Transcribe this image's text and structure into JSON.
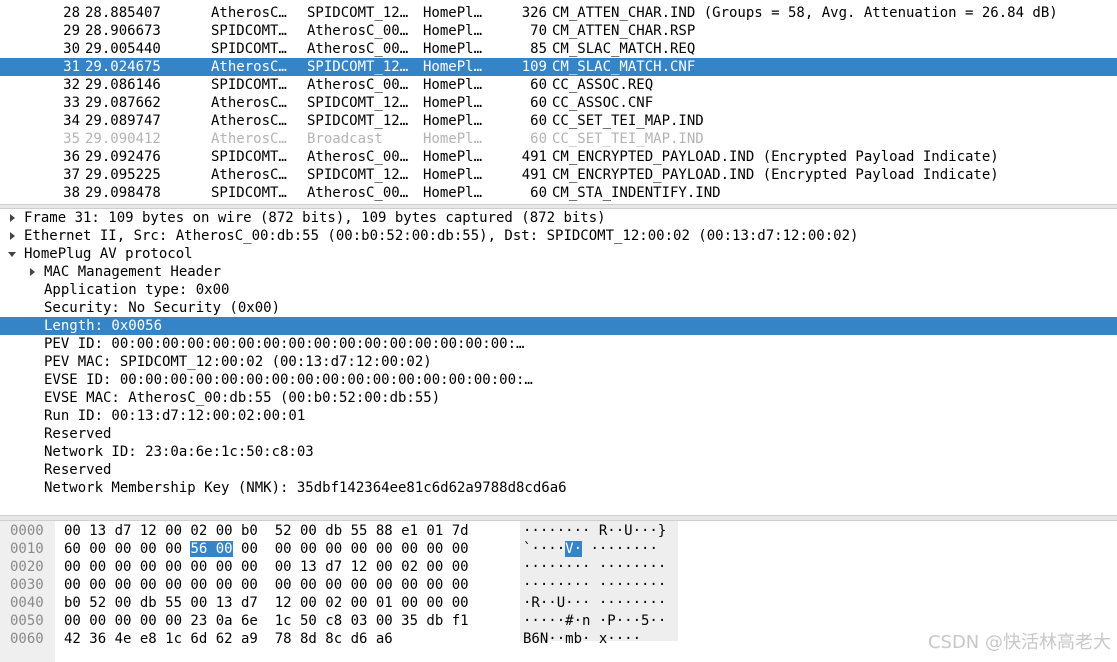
{
  "packet_list": {
    "rows": [
      {
        "no": "28",
        "time": "28.885407",
        "src": "AtherosC…",
        "dst": "SPIDCOMT_12…",
        "proto": "HomePl…",
        "len": "326",
        "info": "CM_ATTEN_CHAR.IND (Groups = 58, Avg. Attenuation = 26.84 dB)"
      },
      {
        "no": "29",
        "time": "28.906673",
        "src": "SPIDCOMT…",
        "dst": "AtherosC_00…",
        "proto": "HomePl…",
        "len": "70",
        "info": "CM_ATTEN_CHAR.RSP"
      },
      {
        "no": "30",
        "time": "29.005440",
        "src": "SPIDCOMT…",
        "dst": "AtherosC_00…",
        "proto": "HomePl…",
        "len": "85",
        "info": "CM_SLAC_MATCH.REQ"
      },
      {
        "no": "31",
        "time": "29.024675",
        "src": "AtherosC…",
        "dst": "SPIDCOMT_12…",
        "proto": "HomePl…",
        "len": "109",
        "info": "CM_SLAC_MATCH.CNF",
        "selected": true
      },
      {
        "no": "32",
        "time": "29.086146",
        "src": "SPIDCOMT…",
        "dst": "AtherosC_00…",
        "proto": "HomePl…",
        "len": "60",
        "info": "CC_ASSOC.REQ"
      },
      {
        "no": "33",
        "time": "29.087662",
        "src": "AtherosC…",
        "dst": "SPIDCOMT_12…",
        "proto": "HomePl…",
        "len": "60",
        "info": "CC_ASSOC.CNF"
      },
      {
        "no": "34",
        "time": "29.089747",
        "src": "AtherosC…",
        "dst": "SPIDCOMT_12…",
        "proto": "HomePl…",
        "len": "60",
        "info": "CC_SET_TEI_MAP.IND"
      },
      {
        "no": "35",
        "time": "29.090412",
        "src": "AtherosC…",
        "dst": "Broadcast",
        "proto": "HomePl…",
        "len": "60",
        "info": "CC_SET_TEI_MAP.IND",
        "dimmed": true
      },
      {
        "no": "36",
        "time": "29.092476",
        "src": "SPIDCOMT…",
        "dst": "AtherosC_00…",
        "proto": "HomePl…",
        "len": "491",
        "info": "CM_ENCRYPTED_PAYLOAD.IND (Encrypted Payload Indicate)"
      },
      {
        "no": "37",
        "time": "29.095225",
        "src": "AtherosC…",
        "dst": "SPIDCOMT_12…",
        "proto": "HomePl…",
        "len": "491",
        "info": "CM_ENCRYPTED_PAYLOAD.IND (Encrypted Payload Indicate)"
      },
      {
        "no": "38",
        "time": "29.098478",
        "src": "SPIDCOMT…",
        "dst": "AtherosC_00…",
        "proto": "HomePl…",
        "len": "60",
        "info": "CM_STA_INDENTIFY.IND"
      }
    ]
  },
  "details": {
    "rows": [
      {
        "text": "Frame 31: 109 bytes on wire (872 bits), 109 bytes captured (872 bits)",
        "depth": 0,
        "expander": "collapsed"
      },
      {
        "text": "Ethernet II, Src: AtherosC_00:db:55 (00:b0:52:00:db:55), Dst: SPIDCOMT_12:00:02 (00:13:d7:12:00:02)",
        "depth": 0,
        "expander": "collapsed"
      },
      {
        "text": "HomePlug AV protocol",
        "depth": 0,
        "expander": "expanded"
      },
      {
        "text": "MAC Management Header",
        "depth": 1,
        "expander": "collapsed"
      },
      {
        "text": "Application type: 0x00",
        "depth": 1,
        "expander": "none"
      },
      {
        "text": "Security: No Security (0x00)",
        "depth": 1,
        "expander": "none"
      },
      {
        "text": "Length: 0x0056",
        "depth": 1,
        "expander": "none",
        "selected": true
      },
      {
        "text": "PEV ID: 00:00:00:00:00:00:00:00:00:00:00:00:00:00:00:00:…",
        "depth": 1,
        "expander": "none"
      },
      {
        "text": "PEV MAC: SPIDCOMT_12:00:02 (00:13:d7:12:00:02)",
        "depth": 1,
        "expander": "none"
      },
      {
        "text": "EVSE ID: 00:00:00:00:00:00:00:00:00:00:00:00:00:00:00:00:…",
        "depth": 1,
        "expander": "none"
      },
      {
        "text": "EVSE MAC: AtherosC_00:db:55 (00:b0:52:00:db:55)",
        "depth": 1,
        "expander": "none"
      },
      {
        "text": "Run ID: 00:13:d7:12:00:02:00:01",
        "depth": 1,
        "expander": "none"
      },
      {
        "text": "Reserved",
        "depth": 1,
        "expander": "none"
      },
      {
        "text": "Network ID: 23:0a:6e:1c:50:c8:03",
        "depth": 1,
        "expander": "none"
      },
      {
        "text": "Reserved",
        "depth": 1,
        "expander": "none"
      },
      {
        "text": "Network Membership Key (NMK): 35dbf142364ee81c6d62a9788d8cd6a6",
        "depth": 1,
        "expander": "none"
      }
    ]
  },
  "bytes": {
    "rows": [
      {
        "offset": "0000",
        "hex": [
          "00 13 d7 12 00 02 00 b0  52 00 db 55 88 e1 01 7d"
        ],
        "ascii": [
          "········ R··U···}"
        ]
      },
      {
        "offset": "0010",
        "hex": [
          "60 00 00 00 00 ",
          "56 00",
          " 00  00 00 00 00 00 00 00 00"
        ],
        "ascii": [
          "`····",
          "V·",
          " ········"
        ],
        "highlight_index": 1
      },
      {
        "offset": "0020",
        "hex": [
          "00 00 00 00 00 00 00 00  00 13 d7 12 00 02 00 00"
        ],
        "ascii": [
          "········ ········"
        ]
      },
      {
        "offset": "0030",
        "hex": [
          "00 00 00 00 00 00 00 00  00 00 00 00 00 00 00 00"
        ],
        "ascii": [
          "········ ········"
        ]
      },
      {
        "offset": "0040",
        "hex": [
          "b0 52 00 db 55 00 13 d7  12 00 02 00 01 00 00 00"
        ],
        "ascii": [
          "·R··U··· ········"
        ]
      },
      {
        "offset": "0050",
        "hex": [
          "00 00 00 00 00 23 0a 6e  1c 50 c8 03 00 35 db f1"
        ],
        "ascii": [
          "·····#·n ·P···5··"
        ]
      },
      {
        "offset": "0060",
        "hex": [
          "42 36 4e e8 1c 6d 62 a9  78 8d 8c d6 a6"
        ],
        "ascii": [
          "B6N··mb· x····"
        ]
      }
    ]
  },
  "watermark": "CSDN @快活林高老大",
  "colors": {
    "selection": "#3584c8",
    "dimmed_text": "#b4b4b4",
    "offset_text": "#8a8a8a"
  }
}
